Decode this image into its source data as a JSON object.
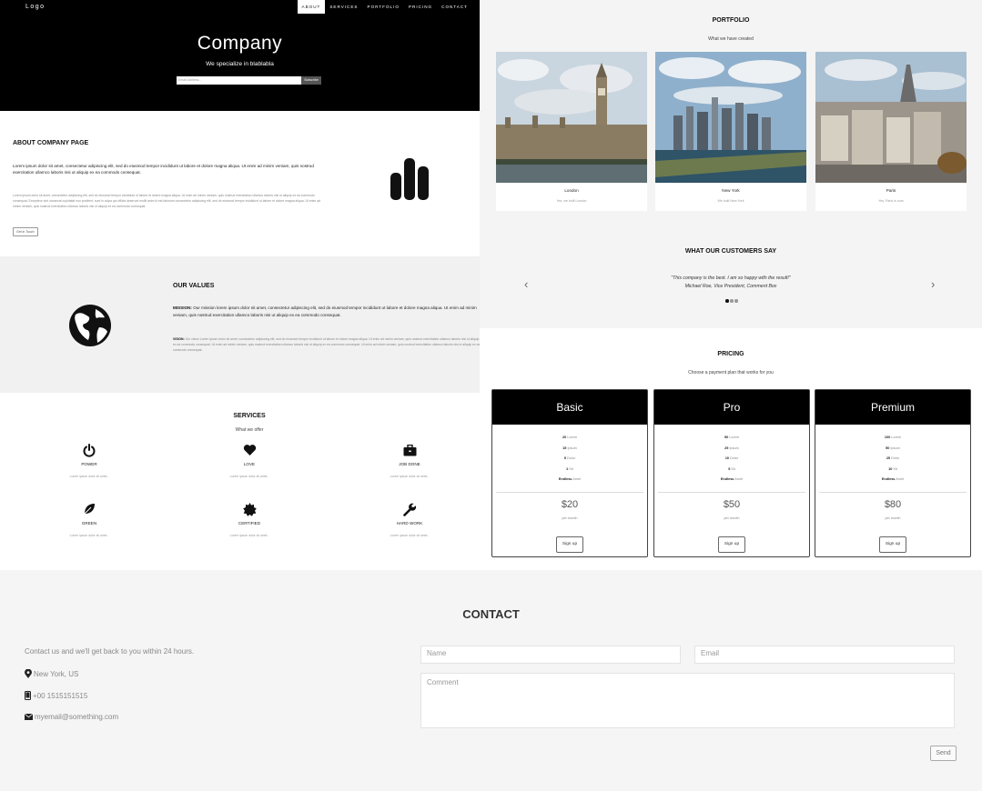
{
  "hero": {
    "logo": "Logo",
    "nav": [
      "ABOUT",
      "SERVICES",
      "PORTFOLIO",
      "PRICING",
      "CONTACT"
    ],
    "title": "Company",
    "subtitle": "We specialize in blablabla",
    "email_placeholder": "Email Address...",
    "subscribe_label": "Subscribe"
  },
  "about": {
    "title": "ABOUT COMPANY PAGE",
    "lead": "Lorem ipsum dolor sit amet, consectetur adipiscing elit, sed do eiusmod tempor incididunt ut labore et dolore magna aliqua. Ut enim ad minim veniam, quis nostrud exercitation ullamco laboris nisi ut aliquip ex ea commodo consequat.",
    "body": "Lorem ipsum dolor sit amet, consectetur adipiscing elit, sed do eiusmod tempor incididunt ut labore et dolore magna aliqua. Ut enim ad minim veniam, quis nostrud exercitation ullamco laboris nisi ut aliquip ex ea commodo consequat. Excepteur sint occaecat cupidatat non proident, sunt in culpa qui officia deserunt mollit anim id est laborum consectetur adipiscing elit, sed do eiusmod tempor incididunt ut labore et dolore magna aliqua. Ut enim ad minim veniam, quis nostrud exercitation ullamco laboris nisi ut aliquip ex ea commodo consequat.",
    "button": "Get in Touch",
    "icon": "bar-chart-icon"
  },
  "values": {
    "title": "OUR VALUES",
    "mission_label": "MISSION:",
    "mission_text": " Our mission lorem ipsum dolor sit amet, consectetur adipiscing elit, sed do eiusmod tempor incididunt ut labore et dolore magna aliqua. Ut enim ad minim veniam, quis nostrud exercitation ullamco laboris nisi ut aliquip ex ea commodo consequat.",
    "vision_label": "VISION:",
    "vision_text": " Our vision Lorem ipsum dolor sit amet, consectetur adipiscing elit, sed do eiusmod tempor incididunt ut labore et dolore magna aliqua. Ut enim ad minim veniam, quis nostrud exercitation ullamco laboris nisi ut aliquip ex ea commodo consequat. Ut enim ad minim veniam, quis nostrud exercitation ullamco laboris nisi ut aliquip ex ea commodo consequat. Ut enim ad minim veniam, quis nostrud exercitation ullamco laboris nisi ut aliquip ex ea commodo consequat.",
    "icon": "globe-icon"
  },
  "services": {
    "title": "SERVICES",
    "tagline": "What we offer",
    "items": [
      {
        "name": "POWER",
        "desc": "Lorem ipsum dolor sit amet..",
        "icon": "power-icon"
      },
      {
        "name": "LOVE",
        "desc": "Lorem ipsum dolor sit amet..",
        "icon": "heart-icon"
      },
      {
        "name": "JOB DONE",
        "desc": "Lorem ipsum dolor sit amet..",
        "icon": "briefcase-icon"
      },
      {
        "name": "GREEN",
        "desc": "Lorem ipsum dolor sit amet..",
        "icon": "leaf-icon"
      },
      {
        "name": "CERTIFIED",
        "desc": "Lorem ipsum dolor sit amet..",
        "icon": "certificate-icon"
      },
      {
        "name": "HARD WORK",
        "desc": "Lorem ipsum dolor sit amet..",
        "icon": "wrench-icon"
      }
    ]
  },
  "portfolio": {
    "title": "PORTFOLIO",
    "tagline": "What we have created",
    "items": [
      {
        "city": "London",
        "desc": "Yes, we built London"
      },
      {
        "city": "New York",
        "desc": "We built New York"
      },
      {
        "city": "Paris",
        "desc": "Yes, Paris is ours"
      }
    ]
  },
  "testimonials": {
    "title": "WHAT OUR CUSTOMERS SAY",
    "quote": "\"This company is the best. I am so happy with the result!\"",
    "author": "Michael Roe, Vice President, Comment Box",
    "prev": "‹",
    "next": "›"
  },
  "pricing": {
    "title": "PRICING",
    "tagline": "Choose a payment plan that works for you",
    "plans": [
      {
        "name": "Basic",
        "f": [
          [
            "20",
            " Lorem"
          ],
          [
            "15",
            " Ipsum"
          ],
          [
            "5",
            " Dolor"
          ],
          [
            "2",
            " Sit"
          ],
          [
            "Endless",
            " Amet"
          ]
        ],
        "price": "$20",
        "period": "per month",
        "button": "Sign up"
      },
      {
        "name": "Pro",
        "f": [
          [
            "50",
            " Lorem"
          ],
          [
            "25",
            " Ipsum"
          ],
          [
            "10",
            " Dolor"
          ],
          [
            "5",
            " Sit"
          ],
          [
            "Endless",
            " Amet"
          ]
        ],
        "price": "$50",
        "period": "per month",
        "button": "Sign up"
      },
      {
        "name": "Premium",
        "f": [
          [
            "100",
            " Lorem"
          ],
          [
            "50",
            " Ipsum"
          ],
          [
            "25",
            " Dolor"
          ],
          [
            "10",
            " Sit"
          ],
          [
            "Endless",
            " Amet"
          ]
        ],
        "price": "$80",
        "period": "per month",
        "button": "Sign up"
      }
    ]
  },
  "contact": {
    "title": "CONTACT",
    "intro": "Contact us and we'll get back to you within 24 hours.",
    "location": "New York, US",
    "phone": "+00 1515151515",
    "email": "myemail@something.com",
    "name_placeholder": "Name",
    "email_placeholder": "Email",
    "comment_placeholder": "Comment",
    "send_label": "Send"
  }
}
